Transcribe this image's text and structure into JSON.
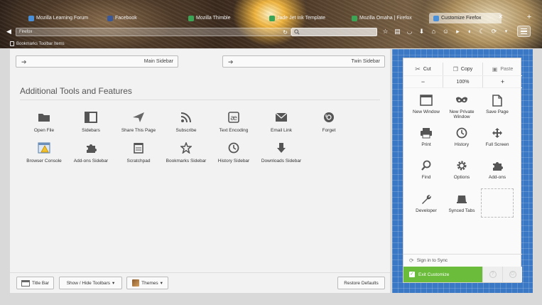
{
  "tabs": [
    {
      "title": "Mozilla Learning Forum",
      "selected": false
    },
    {
      "title": "Facebook",
      "selected": false
    },
    {
      "title": "Mozilla Thimble",
      "selected": false
    },
    {
      "title": "Jade Jet Ink Template",
      "selected": false
    },
    {
      "title": "Mozilla Omaha | Firefox",
      "selected": false
    },
    {
      "title": "Customize Firefox",
      "selected": true
    }
  ],
  "navbar": {
    "url_value": "Firefox",
    "search_placeholder": ""
  },
  "bookmarks_bar": {
    "label": "Bookmarks Toolbar Items"
  },
  "sidebars": {
    "main": "Main Sidebar",
    "twin": "Twin Sidebar"
  },
  "tools": {
    "heading": "Additional Tools and Features",
    "items": [
      {
        "label": "Open File",
        "icon": "folder-icon"
      },
      {
        "label": "Sidebars",
        "icon": "sidebars-icon"
      },
      {
        "label": "Share This Page",
        "icon": "share-icon"
      },
      {
        "label": "Subscribe",
        "icon": "rss-icon"
      },
      {
        "label": "Text Encoding",
        "icon": "text-encoding-icon"
      },
      {
        "label": "Email Link",
        "icon": "email-icon"
      },
      {
        "label": "Forget",
        "icon": "forget-icon"
      },
      {
        "label": "Browser Console",
        "icon": "browser-console-icon"
      },
      {
        "label": "Add-ons Sidebar",
        "icon": "puzzle-icon"
      },
      {
        "label": "Scratchpad",
        "icon": "scratchpad-icon"
      },
      {
        "label": "Bookmarks Sidebar",
        "icon": "star-icon"
      },
      {
        "label": "History Sidebar",
        "icon": "clock-icon"
      },
      {
        "label": "Downloads Sidebar",
        "icon": "download-icon"
      }
    ]
  },
  "bottom_bar": {
    "title_bar": "Title Bar",
    "toolbars": "Show / Hide Toolbars",
    "themes": "Themes",
    "restore": "Restore Defaults"
  },
  "panel": {
    "edit": {
      "cut": "Cut",
      "copy": "Copy",
      "paste": "Paste"
    },
    "zoom": {
      "minus": "−",
      "value": "100%",
      "plus": "+"
    },
    "items": [
      {
        "label": "New Window",
        "icon": "new-window-icon"
      },
      {
        "label": "New Private Window",
        "icon": "private-window-icon"
      },
      {
        "label": "Save Page",
        "icon": "save-page-icon"
      },
      {
        "label": "Print",
        "icon": "print-icon"
      },
      {
        "label": "History",
        "icon": "history-icon"
      },
      {
        "label": "Full Screen",
        "icon": "fullscreen-icon"
      },
      {
        "label": "Find",
        "icon": "find-icon"
      },
      {
        "label": "Options",
        "icon": "options-icon"
      },
      {
        "label": "Add-ons",
        "icon": "addons-icon"
      },
      {
        "label": "Developer",
        "icon": "developer-icon"
      },
      {
        "label": "Synced Tabs",
        "icon": "synced-tabs-icon"
      }
    ],
    "sign_in": "Sign in to Sync",
    "exit": "Exit Customize"
  },
  "colors": {
    "exit_green": "#6abc3a",
    "blueprint": "#3a78c6",
    "icon_gray": "#555555"
  }
}
